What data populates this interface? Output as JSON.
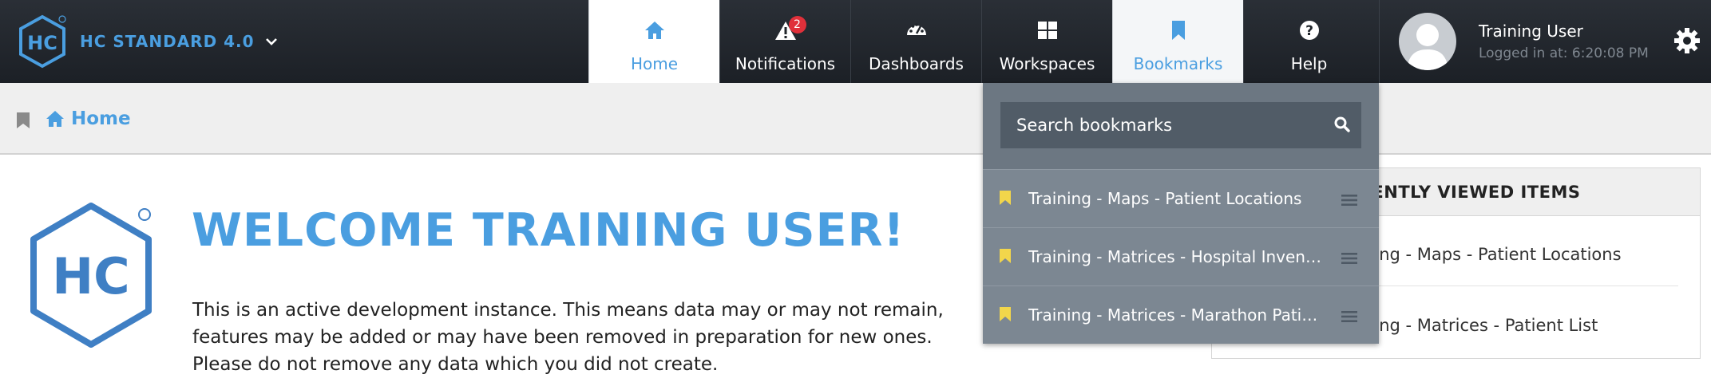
{
  "brand": {
    "name": "HC STANDARD 4.0"
  },
  "nav": {
    "tabs": [
      {
        "label": "Home",
        "icon": "home-icon"
      },
      {
        "label": "Notifications",
        "icon": "alert-icon",
        "badge": "2"
      },
      {
        "label": "Dashboards",
        "icon": "dashboard-icon"
      },
      {
        "label": "Workspaces",
        "icon": "grid-icon"
      },
      {
        "label": "Bookmarks",
        "icon": "bookmark-icon"
      },
      {
        "label": "Help",
        "icon": "help-icon"
      }
    ]
  },
  "user": {
    "name": "Training User",
    "login": "Logged in at: 6:20:08 PM"
  },
  "breadcrumb": {
    "home": "Home"
  },
  "main": {
    "welcome": "WELCOME TRAINING USER!",
    "intro": "This is an active development instance. This means data may or may not remain, features may be added or may have been removed in preparation for new ones. Please do not remove any data which you did not create."
  },
  "recent": {
    "heading": "RECENTLY VIEWED ITEMS",
    "items": [
      "Training - Maps - Patient Locations",
      "Training - Matrices - Patient List"
    ]
  },
  "bookmarks": {
    "search_placeholder": "Search bookmarks",
    "items": [
      "Training - Maps - Patient Locations",
      "Training - Matrices - Hospital Inventory",
      "Training - Matrices - Marathon Patient List"
    ]
  },
  "colors": {
    "accent": "#4a9ee0",
    "topbar": "#1f242a",
    "badge": "#e0303a",
    "bookmark_flag": "#f2d64b"
  }
}
